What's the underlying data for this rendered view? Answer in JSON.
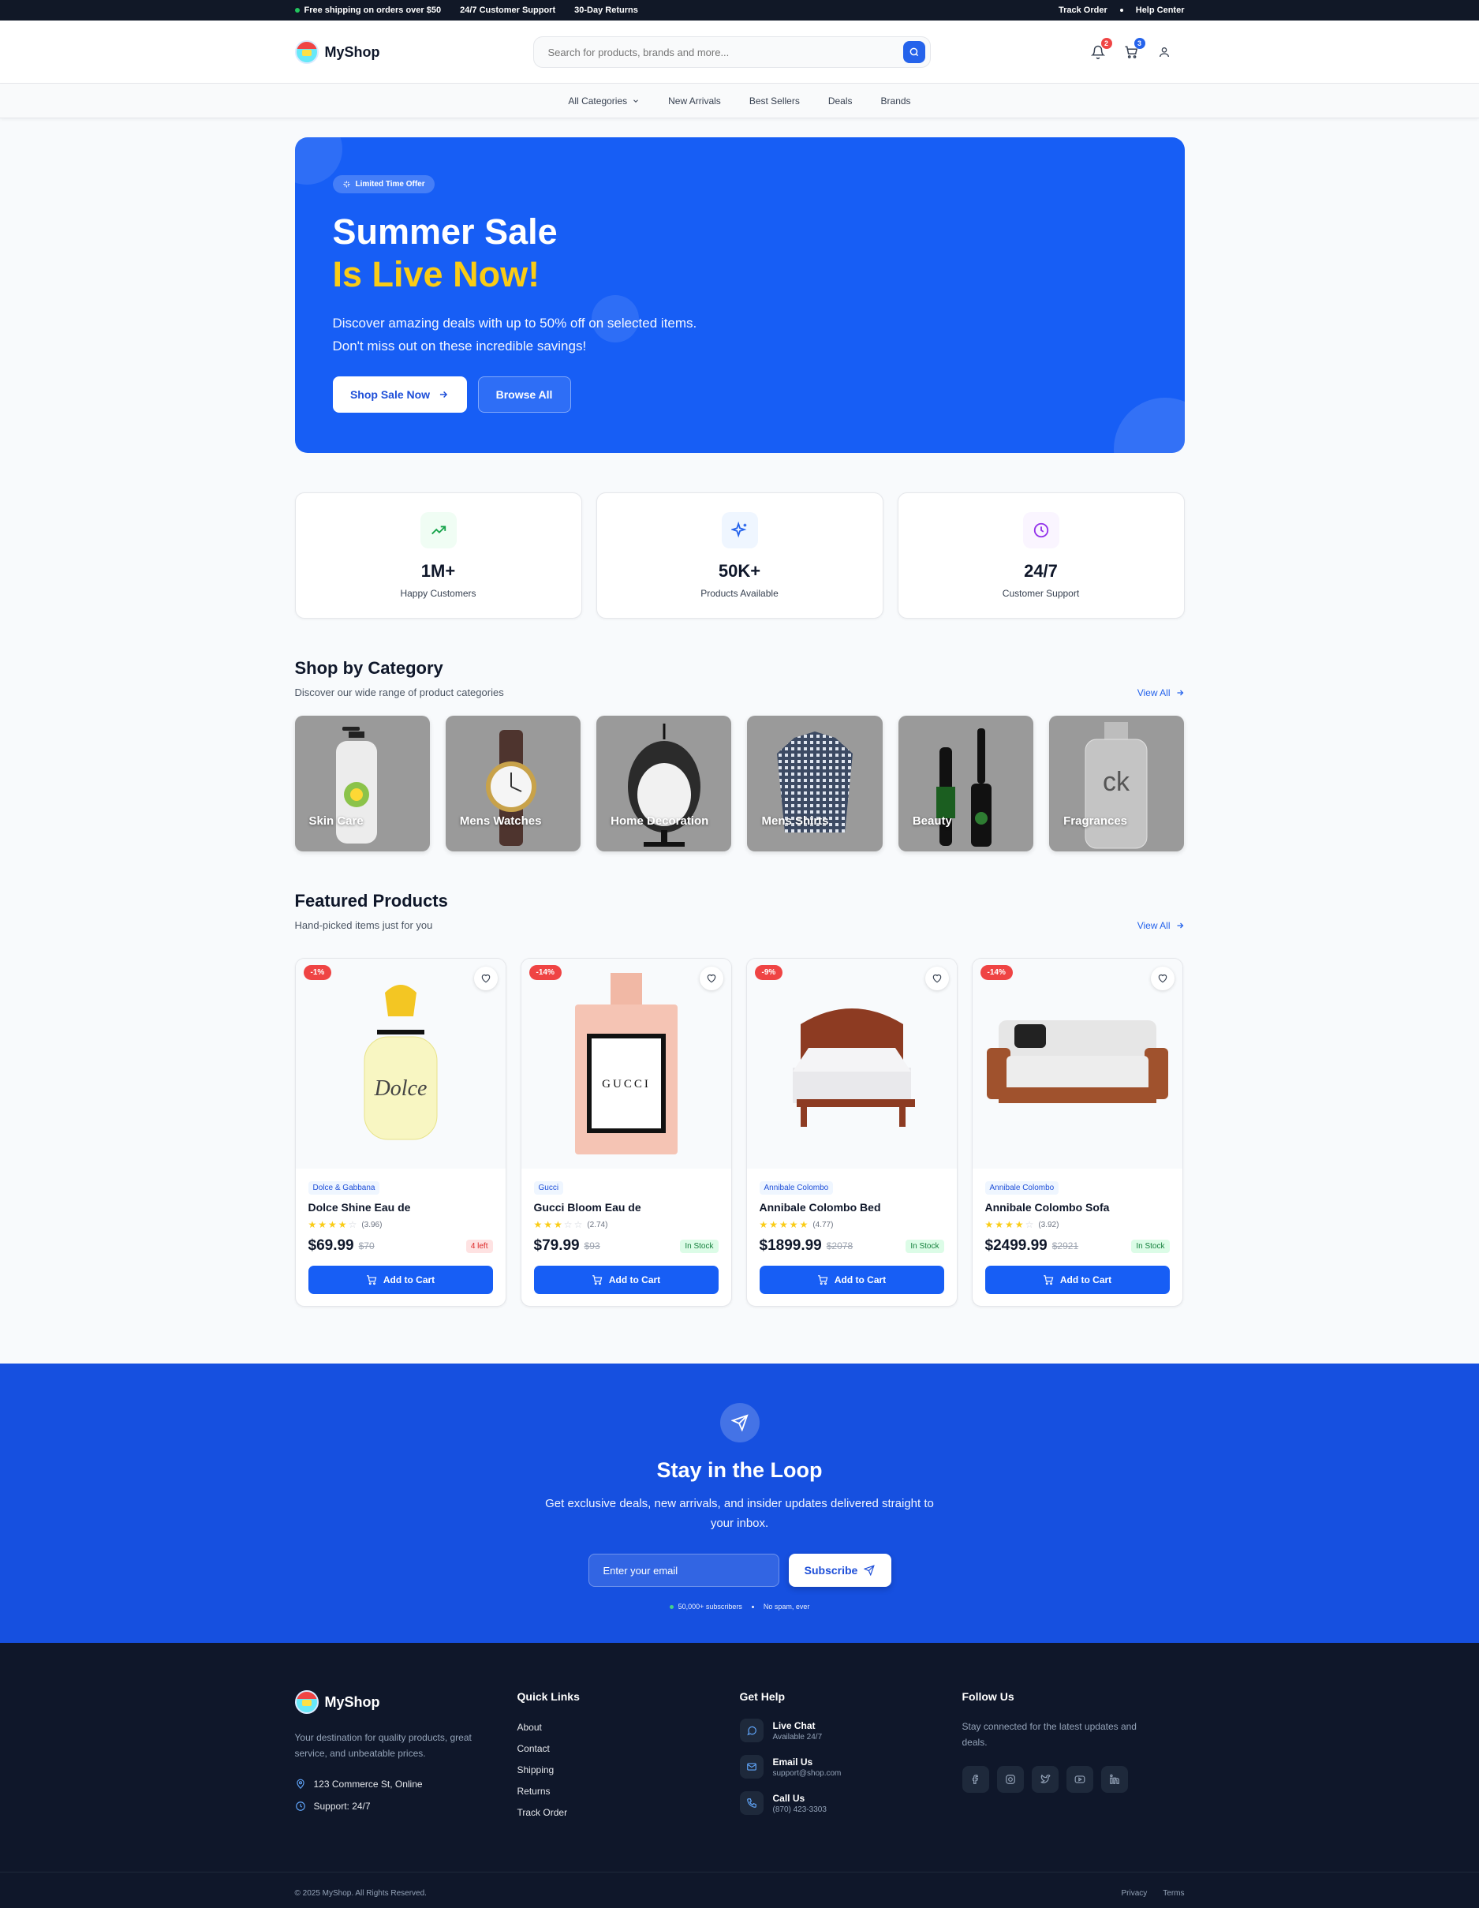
{
  "topbar": {
    "shipping": "Free shipping on orders over $50",
    "support": "24/7 Customer Support",
    "returns": "30-Day Returns",
    "track": "Track Order",
    "help": "Help Center"
  },
  "header": {
    "brand": "MyShop",
    "search_placeholder": "Search for products, brands and more...",
    "notifications_count": "2",
    "cart_count": "3"
  },
  "nav": {
    "items": [
      "All Categories",
      "New Arrivals",
      "Best Sellers",
      "Deals",
      "Brands"
    ]
  },
  "hero": {
    "badge": "Limited Time Offer",
    "title_line1": "Summer Sale",
    "title_line2": "Is Live Now!",
    "desc_line1": "Discover amazing deals with up to 50% off on selected items.",
    "desc_line2": "Don't miss out on these incredible savings!",
    "primary_btn": "Shop Sale Now",
    "secondary_btn": "Browse All"
  },
  "stats": [
    {
      "value": "1M+",
      "label": "Happy Customers",
      "icon": "trending-up-icon",
      "color": "#16a34a",
      "bg": "#f0fdf4"
    },
    {
      "value": "50K+",
      "label": "Products Available",
      "icon": "sparkles-icon",
      "color": "#2563eb",
      "bg": "#eff6ff"
    },
    {
      "value": "24/7",
      "label": "Customer Support",
      "icon": "clock-icon",
      "color": "#9333ea",
      "bg": "#faf5ff"
    }
  ],
  "categories_section": {
    "title": "Shop by Category",
    "subtitle": "Discover our wide range of product categories",
    "view_all": "View All",
    "items": [
      "Skin Care",
      "Mens Watches",
      "Home Decoration",
      "Mens Shirts",
      "Beauty",
      "Fragrances"
    ]
  },
  "featured": {
    "title": "Featured Products",
    "subtitle": "Hand-picked items just for you",
    "view_all": "View All",
    "add_to_cart": "Add to Cart",
    "products": [
      {
        "discount": "-1%",
        "brand": "Dolce & Gabbana",
        "name": "Dolce Shine Eau de",
        "rating": 3.96,
        "rating_text": "(3.96)",
        "price": "$69.99",
        "old_price": "$70",
        "stock": "4 left",
        "low_stock": true
      },
      {
        "discount": "-14%",
        "brand": "Gucci",
        "name": "Gucci Bloom Eau de",
        "rating": 2.74,
        "rating_text": "(2.74)",
        "price": "$79.99",
        "old_price": "$93",
        "stock": "In Stock",
        "low_stock": false
      },
      {
        "discount": "-9%",
        "brand": "Annibale Colombo",
        "name": "Annibale Colombo Bed",
        "rating": 4.77,
        "rating_text": "(4.77)",
        "price": "$1899.99",
        "old_price": "$2078",
        "stock": "In Stock",
        "low_stock": false
      },
      {
        "discount": "-14%",
        "brand": "Annibale Colombo",
        "name": "Annibale Colombo Sofa",
        "rating": 3.92,
        "rating_text": "(3.92)",
        "price": "$2499.99",
        "old_price": "$2921",
        "stock": "In Stock",
        "low_stock": false
      }
    ]
  },
  "newsletter": {
    "title": "Stay in the Loop",
    "desc": "Get exclusive deals, new arrivals, and insider updates delivered straight to your inbox.",
    "placeholder": "Enter your email",
    "button": "Subscribe",
    "subscribers": "50,000+ subscribers",
    "no_spam": "No spam, ever"
  },
  "footer": {
    "brand": "MyShop",
    "desc": "Your destination for quality products, great service, and unbeatable prices.",
    "address": "123 Commerce St, Online",
    "support": "Support: 24/7",
    "quick_links_title": "Quick Links",
    "quick_links": [
      "About",
      "Contact",
      "Shipping",
      "Returns",
      "Track Order"
    ],
    "help_title": "Get Help",
    "help": [
      {
        "title": "Live Chat",
        "sub": "Available 24/7"
      },
      {
        "title": "Email Us",
        "sub": "support@shop.com"
      },
      {
        "title": "Call Us",
        "sub": "(870) 423-3303"
      }
    ],
    "follow_title": "Follow Us",
    "follow_desc": "Stay connected for the latest updates and deals.",
    "copyright": "© 2025 MyShop. All Rights Reserved.",
    "privacy": "Privacy",
    "terms": "Terms"
  }
}
